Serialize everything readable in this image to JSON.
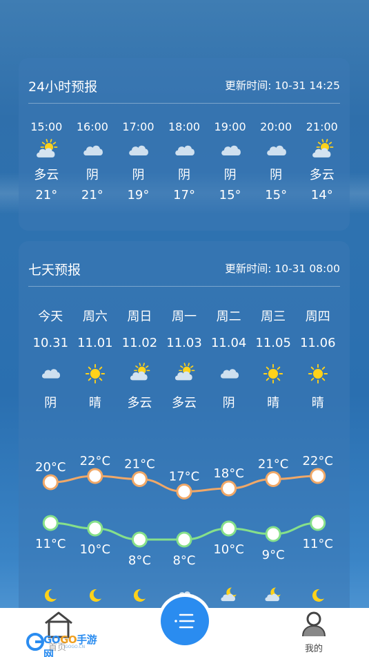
{
  "hourly": {
    "title": "24小时预报",
    "update_label": "更新时间: 10-31 14:25",
    "items": [
      {
        "time": "15:00",
        "icon": "partly-cloudy-icon",
        "cond": "多云",
        "temp": "21°"
      },
      {
        "time": "16:00",
        "icon": "cloud-icon",
        "cond": "阴",
        "temp": "21°"
      },
      {
        "time": "17:00",
        "icon": "cloud-icon",
        "cond": "阴",
        "temp": "19°"
      },
      {
        "time": "18:00",
        "icon": "cloud-icon",
        "cond": "阴",
        "temp": "17°"
      },
      {
        "time": "19:00",
        "icon": "cloud-icon",
        "cond": "阴",
        "temp": "15°"
      },
      {
        "time": "20:00",
        "icon": "cloud-icon",
        "cond": "阴",
        "temp": "15°"
      },
      {
        "time": "21:00",
        "icon": "partly-cloudy-icon",
        "cond": "多云",
        "temp": "14°"
      }
    ]
  },
  "weekly": {
    "title": "七天预报",
    "update_label": "更新时间: 10-31 08:00",
    "days": [
      {
        "name": "今天",
        "date": "10.31",
        "icon": "cloud-icon",
        "cond": "阴",
        "high": "20°C",
        "low": "11°C",
        "night_icon": "moon-icon"
      },
      {
        "name": "周六",
        "date": "11.01",
        "icon": "sun-icon",
        "cond": "晴",
        "high": "22°C",
        "low": "10°C",
        "night_icon": "moon-icon"
      },
      {
        "name": "周日",
        "date": "11.02",
        "icon": "partly-cloudy-icon",
        "cond": "多云",
        "high": "21°C",
        "low": "8°C",
        "night_icon": "moon-icon"
      },
      {
        "name": "周一",
        "date": "11.03",
        "icon": "partly-cloudy-icon",
        "cond": "多云",
        "high": "17°C",
        "low": "8°C",
        "night_icon": "cloud-icon"
      },
      {
        "name": "周二",
        "date": "11.04",
        "icon": "cloud-icon",
        "cond": "阴",
        "high": "18°C",
        "low": "10°C",
        "night_icon": "cloudy-moon-icon"
      },
      {
        "name": "周三",
        "date": "11.05",
        "icon": "sun-icon",
        "cond": "晴",
        "high": "21°C",
        "low": "9°C",
        "night_icon": "cloudy-moon-icon"
      },
      {
        "name": "周四",
        "date": "11.06",
        "icon": "sun-icon",
        "cond": "晴",
        "high": "22°C",
        "low": "11°C",
        "night_icon": "moon-icon"
      }
    ],
    "high_values": [
      20,
      22,
      21,
      17,
      18,
      21,
      22
    ],
    "low_values": [
      11,
      10,
      8,
      8,
      10,
      9,
      11
    ]
  },
  "tabbar": {
    "home_label": "首页",
    "mine_label": "我的",
    "logo_part1": "GO",
    "logo_part2": "GO",
    "logo_part3": "手游网",
    "logo_sub": "GOGO.CN"
  },
  "colors": {
    "high_line": "#f0a868",
    "low_line": "#86e08a",
    "sun": "#ffd21a",
    "accent": "#2a8cf0"
  }
}
